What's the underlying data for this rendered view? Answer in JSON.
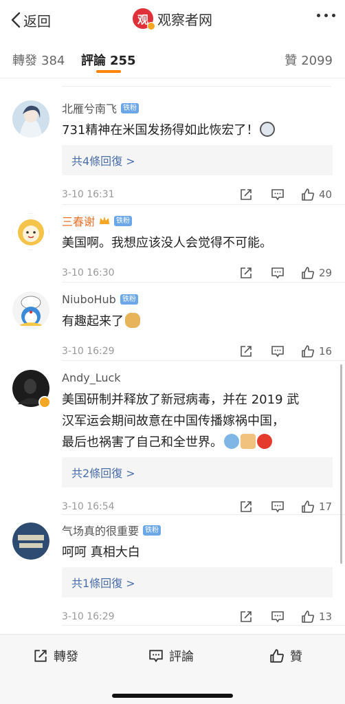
{
  "header": {
    "back_label": "返回",
    "logo_char": "观",
    "title": "观察者网"
  },
  "tabs": [
    {
      "label": "轉發",
      "count": "384"
    },
    {
      "label": "評論",
      "count": "255"
    },
    {
      "label": "贊",
      "count": "2099"
    }
  ],
  "comments": [
    {
      "name": "北雁兮南飞",
      "badge": "铁粉",
      "text": "731精神在米国发扬得如此恢宏了！",
      "replies": "共4條回復 >",
      "time": "3-10 16:31",
      "likes": "40"
    },
    {
      "name": "三春谢",
      "badge": "铁粉",
      "text": "美国啊。我想应该没人会觉得不可能。",
      "time": "3-10 16:30",
      "likes": "29"
    },
    {
      "name": "NiuboHub",
      "badge": "铁粉",
      "text": "有趣起来了",
      "time": "3-10 16:29",
      "likes": "16"
    },
    {
      "name": "Andy_Luck",
      "text_lines": [
        "美国研制并释放了新冠病毒，并在 2019 武",
        "汉军运会期间故意在中国传播嫁祸中国，",
        "最后也祸害了自己和全世界。"
      ],
      "replies": "共2條回復 >",
      "time": "3-10 16:54",
      "likes": "17"
    },
    {
      "name": "气场真的很重要",
      "badge": "铁粉",
      "text": "呵呵 真相大白",
      "replies": "共1條回復 >",
      "time": "3-10 16:29",
      "likes": "13"
    }
  ],
  "bottom_bar": {
    "repost_label": "轉發",
    "comment_label": "評論",
    "like_label": "贊"
  },
  "colors": {
    "accent": "#ff8200",
    "link": "#4a6ea9",
    "fan_badge": "#6aa6e8",
    "brand_red": "#e0303a"
  },
  "icons": [
    "chevron-left-icon",
    "more-dots-icon",
    "repost-icon",
    "comment-icon",
    "like-icon",
    "verified-icon",
    "crown-icon"
  ]
}
